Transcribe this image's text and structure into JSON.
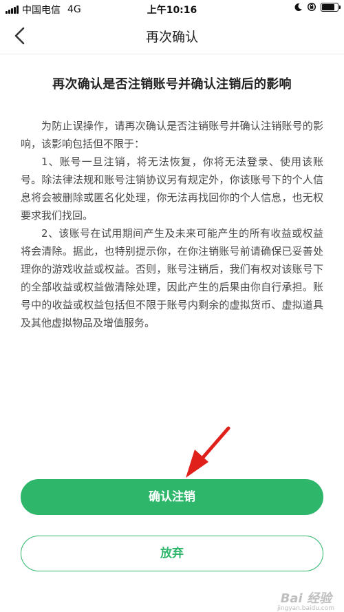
{
  "status_bar": {
    "carrier": "中国电信",
    "network": "4G",
    "time": "上午10:16",
    "icons": [
      "signal-icon",
      "moon-icon",
      "rotation-lock-icon",
      "battery-icon"
    ],
    "battery_level": 0.9
  },
  "nav": {
    "back_icon": "chevron-left-icon",
    "title": "再次确认"
  },
  "content": {
    "title": "再次确认是否注销账号并确认注销后的影响",
    "paragraphs": [
      "为防止误操作，请再次确认是否注销账号并确认注销账号的影响，该影响包括但不限于：",
      "1、账号一旦注销，将无法恢复，你将无法登录、使用该账号。除法律法规和账号注销协议另有规定外，你该账号下的个人信息将会被删除或匿名化处理，你无法再找回你的个人信息，也无权要求我们找回。",
      "2、该账号在试用期间产生及未来可能产生的所有收益或权益将会清除。据此，也特别提示你，在你注销账号前请确保已妥善处理你的游戏收益或权益。否则，账号注销后，我们有权对该账号下的全部收益或权益做清除处理，因此产生的后果由你自行承担。账号中的收益或权益包括但不限于账号内剩余的虚拟货币、虚拟道具及其他虚拟物品及增值服务。"
    ]
  },
  "buttons": {
    "confirm_label": "确认注销",
    "cancel_label": "放弃"
  },
  "colors": {
    "accent": "#2eb66b",
    "annotation_arrow": "#e0201b"
  },
  "watermark": {
    "text": "Bai 经验",
    "sub": "jingyan.baidu.com"
  }
}
